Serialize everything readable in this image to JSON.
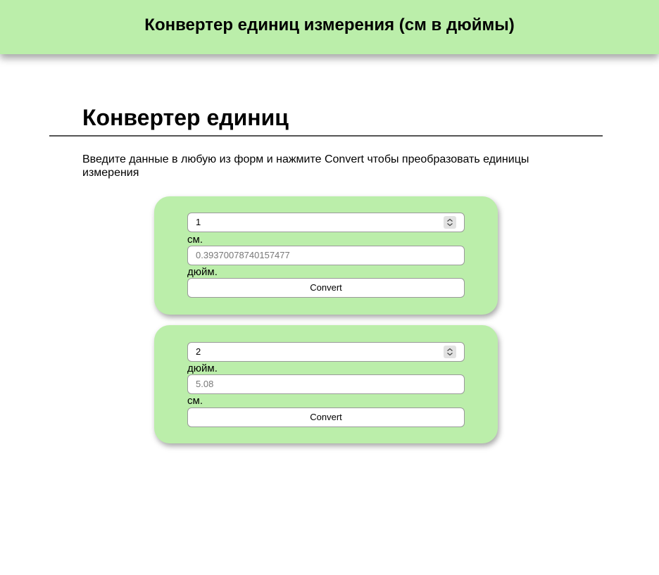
{
  "header": {
    "title": "Конвертер единиц измерения (см в дюймы)"
  },
  "main": {
    "title": "Конвертер единиц",
    "instructions": "Введите данные в любую из форм и нажмите Convert чтобы преобразовать единицы измерения"
  },
  "forms": [
    {
      "input_value": "1",
      "input_unit": "см.",
      "output_placeholder": "0.39370078740157477",
      "output_unit": "дюйм.",
      "button_label": "Convert"
    },
    {
      "input_value": "2",
      "input_unit": "дюйм.",
      "output_placeholder": "5.08",
      "output_unit": "см.",
      "button_label": "Convert"
    }
  ],
  "colors": {
    "accent_green": "#bbeeaa",
    "divider": "#555555"
  },
  "icons": {
    "stepper": "up-down-chevron-icon"
  }
}
